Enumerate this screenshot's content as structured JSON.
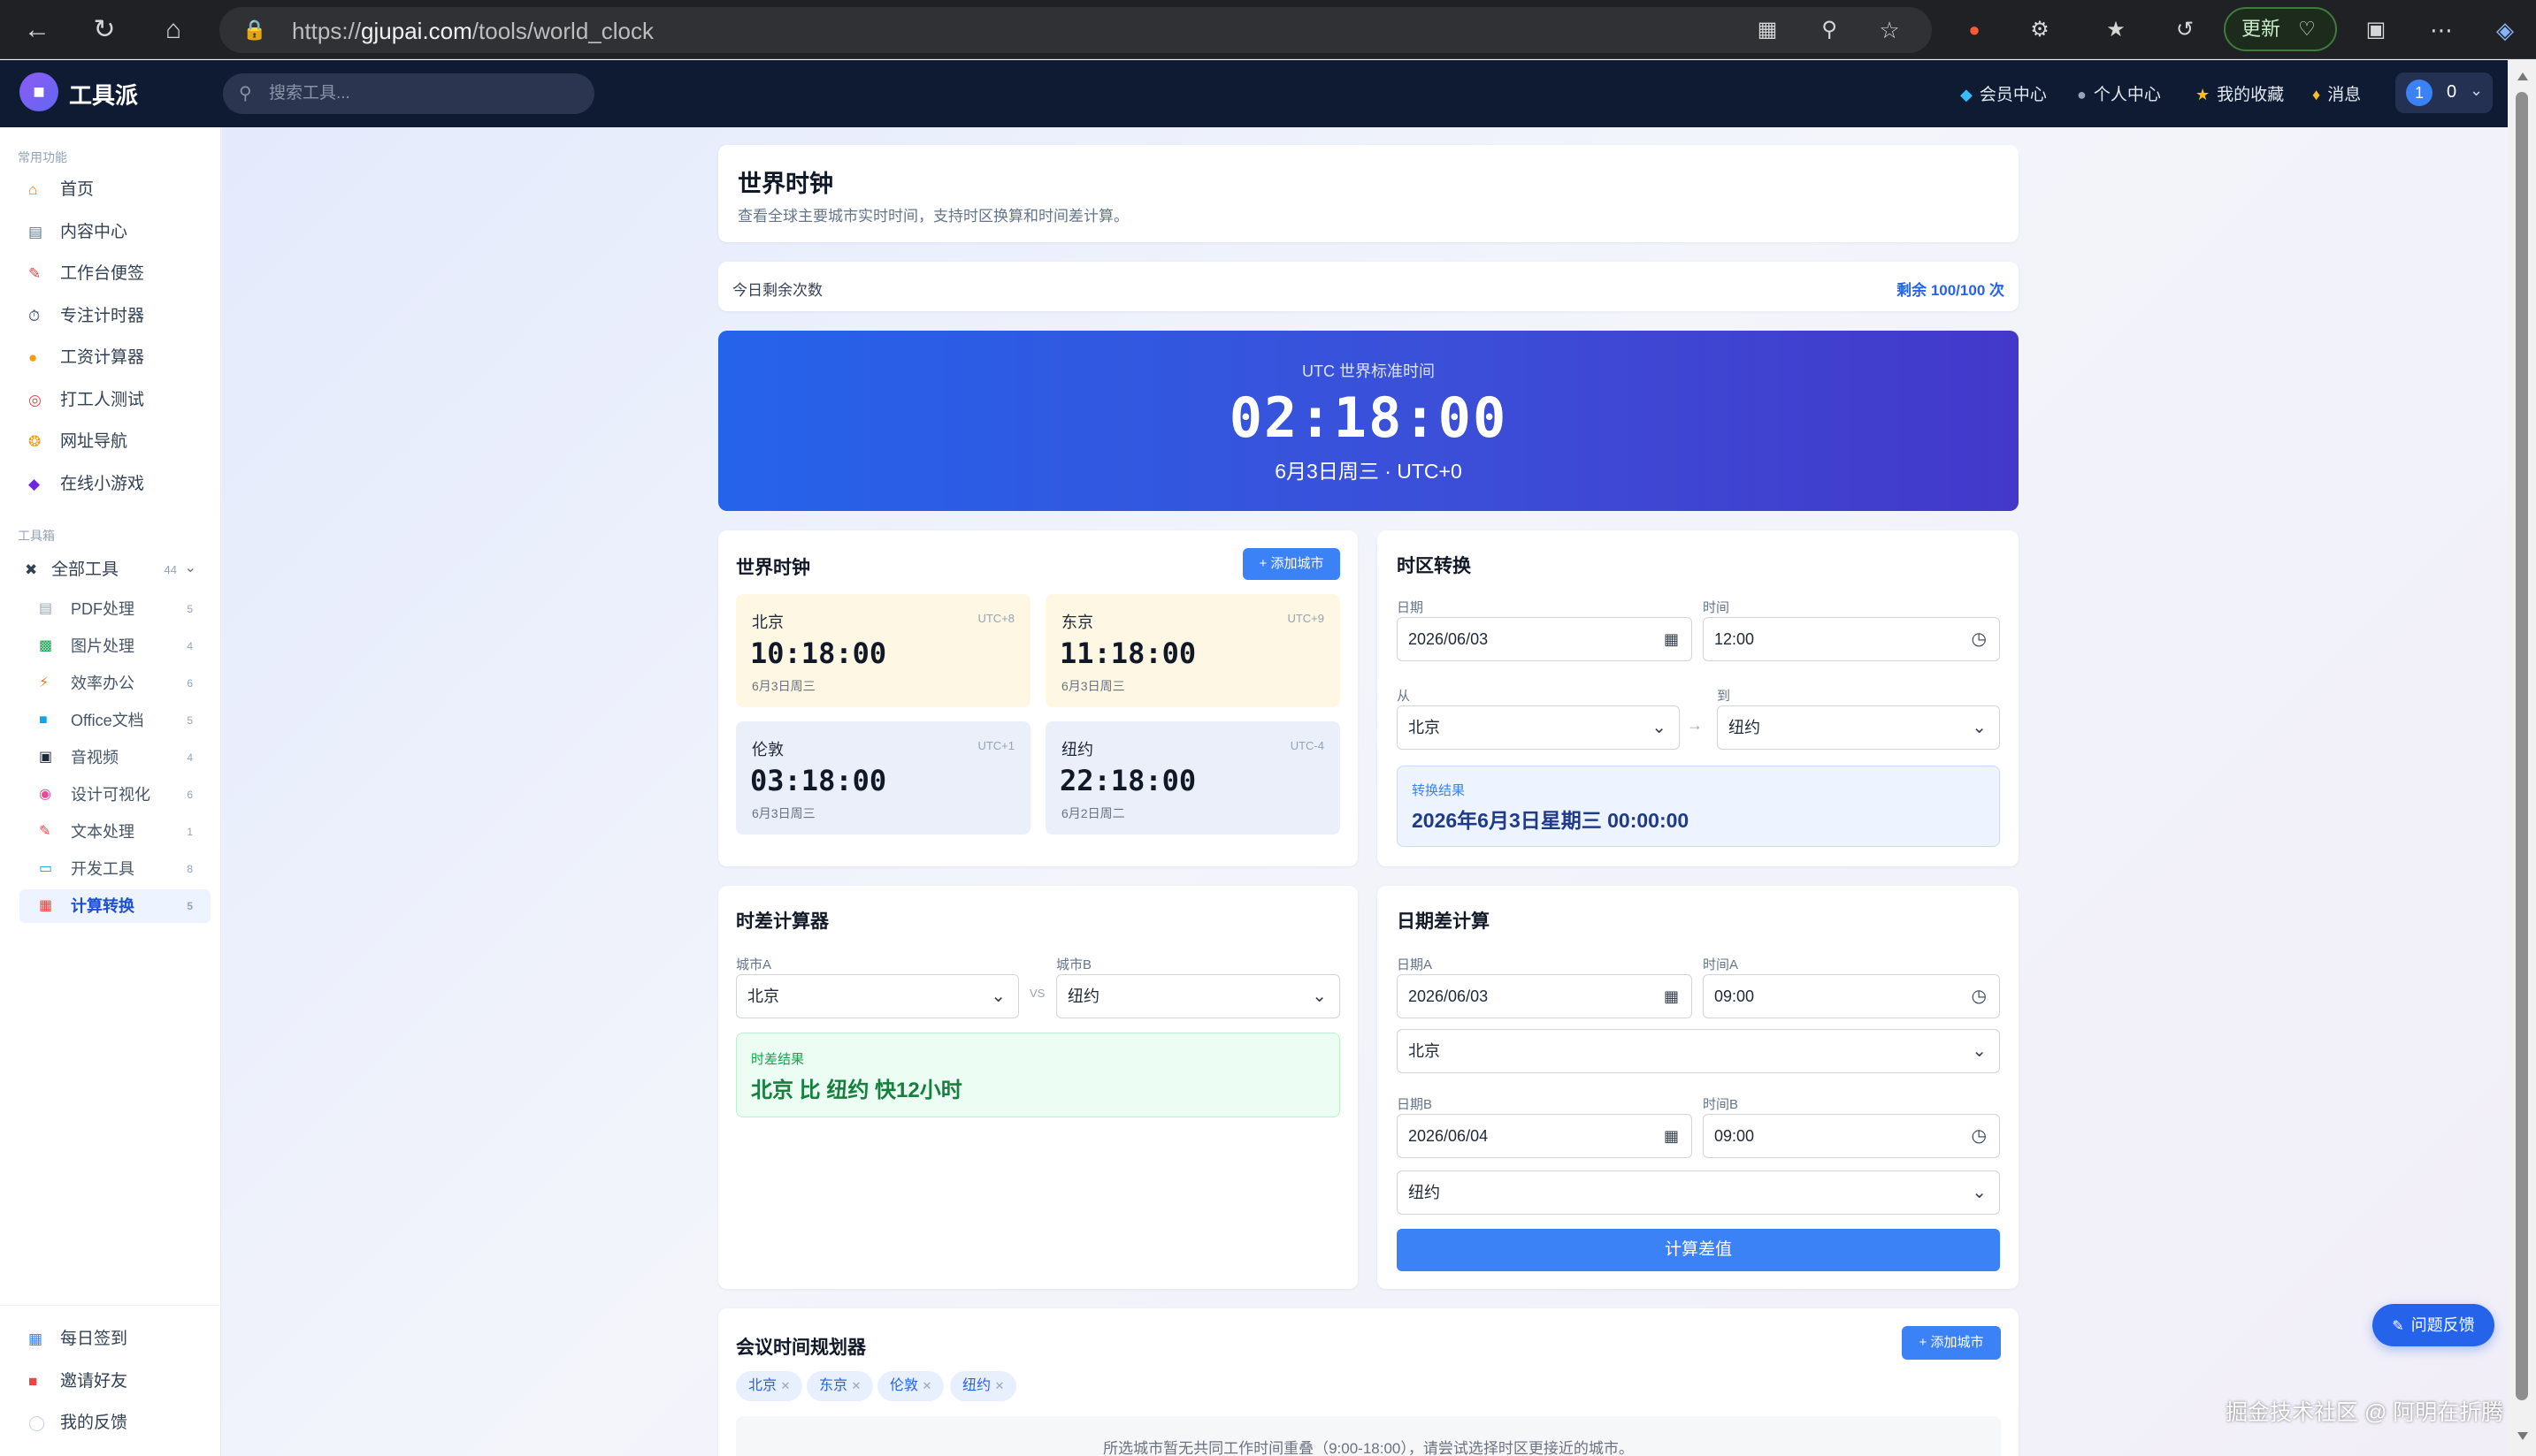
{
  "browser": {
    "url_prefix": "https://",
    "url_host": "gjupai.com",
    "url_path": "/tools/world_clock",
    "update_label": "更新",
    "watermark": "掘金技术社区 @ 阿明在折腾"
  },
  "app": {
    "brand": "工具派",
    "search_placeholder": "搜索工具...",
    "nav": {
      "vip": "会员中心",
      "profile": "个人中心",
      "favorites": "我的收藏",
      "messages": "消息"
    },
    "user_badge": "1",
    "user_value": "0"
  },
  "sidebar": {
    "common_heading": "常用功能",
    "common": [
      "首页",
      "内容中心",
      "工作台便签",
      "专注计时器",
      "工资计算器",
      "打工人测试",
      "网址导航",
      "在线小游戏"
    ],
    "toolbox_heading": "工具箱",
    "all_tools": "全部工具",
    "all_tools_count": "44",
    "categories": [
      {
        "label": "PDF处理",
        "count": "5"
      },
      {
        "label": "图片处理",
        "count": "4"
      },
      {
        "label": "效率办公",
        "count": "6"
      },
      {
        "label": "Office文档",
        "count": "5"
      },
      {
        "label": "音视频",
        "count": "4"
      },
      {
        "label": "设计可视化",
        "count": "6"
      },
      {
        "label": "文本处理",
        "count": "1"
      },
      {
        "label": "开发工具",
        "count": "8"
      },
      {
        "label": "计算转换",
        "count": "5"
      }
    ],
    "bottom": [
      "每日签到",
      "邀请好友",
      "我的反馈"
    ]
  },
  "page": {
    "title": "世界时钟",
    "subtitle": "查看全球主要城市实时时间，支持时区换算和时间差计算。",
    "quota_label": "今日剩余次数",
    "quota_value": "剩余 100/100 次"
  },
  "utc": {
    "label": "UTC 世界标准时间",
    "time": "02:18:00",
    "date": "6月3日周三 · UTC+0"
  },
  "world_clock": {
    "title": "世界时钟",
    "add_button": "+ 添加城市",
    "cities": [
      {
        "name": "北京",
        "tz": "UTC+8",
        "time": "10:18:00",
        "date": "6月3日周三",
        "bg": "#fdf7e3"
      },
      {
        "name": "东京",
        "tz": "UTC+9",
        "time": "11:18:00",
        "date": "6月3日周三",
        "bg": "#fdf7e3"
      },
      {
        "name": "伦敦",
        "tz": "UTC+1",
        "time": "03:18:00",
        "date": "6月3日周三",
        "bg": "#eaeffa"
      },
      {
        "name": "纽约",
        "tz": "UTC-4",
        "time": "22:18:00",
        "date": "6月2日周二",
        "bg": "#eaeffa"
      }
    ]
  },
  "tz_convert": {
    "title": "时区转换",
    "date_label": "日期",
    "date_value": "2026/06/03",
    "time_label": "时间",
    "time_value": "12:00",
    "from_label": "从",
    "from_value": "北京",
    "to_label": "到",
    "to_value": "纽约",
    "arrow": "→",
    "result_label": "转换结果",
    "result_value": "2026年6月3日星期三 00:00:00"
  },
  "diff_calc": {
    "title": "时差计算器",
    "city_a_label": "城市A",
    "city_a": "北京",
    "vs": "VS",
    "city_b_label": "城市B",
    "city_b": "纽约",
    "result_label": "时差结果",
    "result_value": "北京 比 纽约 快12小时"
  },
  "date_diff": {
    "title": "日期差计算",
    "date_a_label": "日期A",
    "date_a": "2026/06/03",
    "time_a_label": "时间A",
    "time_a": "09:00",
    "city_a": "北京",
    "date_b_label": "日期B",
    "date_b": "2026/06/04",
    "time_b_label": "时间B",
    "time_b": "09:00",
    "city_b": "纽约",
    "button": "计算差值"
  },
  "meeting": {
    "title": "会议时间规划器",
    "add_button": "+ 添加城市",
    "chips": [
      "北京",
      "东京",
      "伦敦",
      "纽约"
    ],
    "notice": "所选城市暂无共同工作时间重叠（9:00-18:00），请尝试选择时区更接近的城市。"
  },
  "feedback_button": "问题反馈",
  "colors": {
    "accent": "#3b82f6",
    "header_bg": "#0f1b33",
    "utc_gradient_start": "#2563eb",
    "utc_gradient_end": "#4338ca",
    "success_bg": "#ecfdf3",
    "success_text": "#15803d"
  }
}
